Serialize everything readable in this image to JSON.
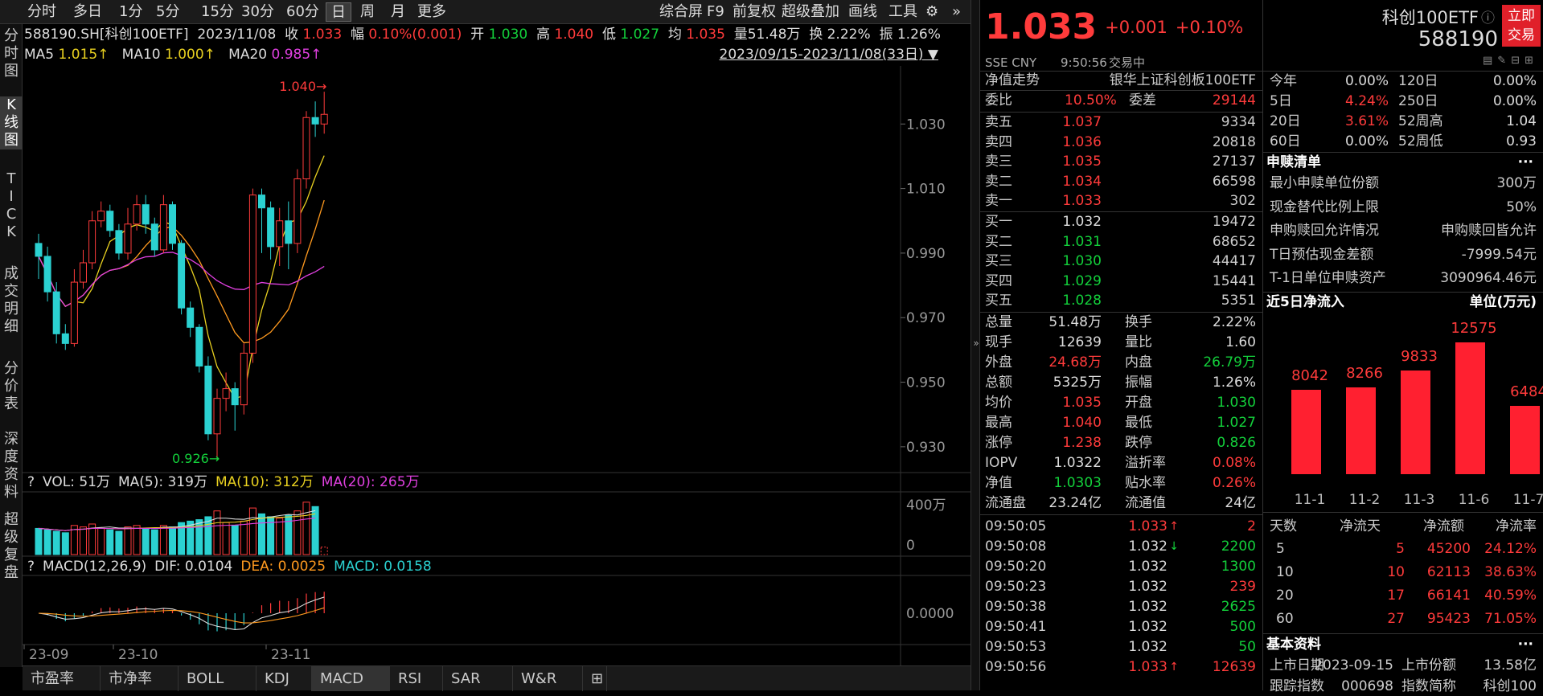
{
  "topbar": {
    "tabs": [
      "分时",
      "多日",
      "1分",
      "5分",
      "15分",
      "30分",
      "60分",
      "日",
      "周",
      "月",
      "更多"
    ],
    "active": "日",
    "tools": [
      "综合屏",
      "F9",
      "前复权",
      "超级叠加",
      "画线",
      "工具"
    ]
  },
  "vtabs": [
    "分时图",
    "K线图",
    "TICK",
    "成交明细",
    "分价表",
    "深度资料",
    "超级复盘"
  ],
  "info": {
    "code": "588190.SH[科创100ETF]",
    "date": "2023/11/08",
    "close_label": "收",
    "close": "1.033",
    "chg_label": "幅",
    "chg": "0.10%(0.001)",
    "open_label": "开",
    "open": "1.030",
    "high_label": "高",
    "high": "1.040",
    "low_label": "低",
    "low": "1.027",
    "avg_label": "均",
    "avg": "1.035",
    "vol_label": "量",
    "vol": "51.48万",
    "turn_label": "换",
    "turn": "2.22%",
    "amp_label": "振",
    "amp": "1.26%"
  },
  "ma": {
    "ma5_label": "MA5",
    "ma5": "1.015↑",
    "ma10_label": "MA10",
    "ma10": "1.000↑",
    "ma20_label": "MA20",
    "ma20": "0.985↑"
  },
  "range": "2023/09/15-2023/11/08(33日)",
  "vol_line": {
    "q": "?",
    "vol": "VOL: 51万",
    "ma5": "MA(5): 319万",
    "ma10": "MA(10): 312万",
    "ma20": "MA(20): 265万"
  },
  "macd_line": {
    "q": "?",
    "name": "MACD(12,26,9)",
    "dif": "DIF: 0.0104",
    "dea": "DEA: 0.0025",
    "macd": "MACD: 0.0158"
  },
  "bottomtabs": [
    "市盈率",
    "市净率",
    "BOLL",
    "KDJ",
    "MACD",
    "RSI",
    "SAR",
    "W&R",
    "⊞"
  ],
  "chart_data": {
    "type": "candlestick",
    "y_ticks": [
      "1.030",
      "1.010",
      "0.990",
      "0.970",
      "0.950",
      "0.930"
    ],
    "vol_ticks": [
      "400万",
      "0"
    ],
    "macd_ticks": [
      "0.0000"
    ],
    "x_ticks": [
      "23-09",
      "23-10",
      "23-11"
    ],
    "high_label": "1.040",
    "low_label": "0.926",
    "ylim": [
      0.922,
      1.048
    ],
    "candles": [
      [
        0.993,
        0.989,
        0.996,
        0.982
      ],
      [
        0.989,
        0.978,
        0.992,
        0.975
      ],
      [
        0.978,
        0.965,
        0.981,
        0.962
      ],
      [
        0.965,
        0.962,
        0.968,
        0.96
      ],
      [
        0.962,
        0.981,
        0.985,
        0.961
      ],
      [
        0.981,
        0.987,
        0.991,
        0.979
      ],
      [
        0.987,
        1.0,
        1.003,
        0.985
      ],
      [
        1.0,
        1.003,
        1.006,
        0.998
      ],
      [
        1.003,
        0.997,
        1.005,
        0.995
      ],
      [
        0.997,
        0.99,
        0.999,
        0.988
      ],
      [
        0.99,
        0.999,
        1.004,
        0.988
      ],
      [
        0.999,
        1.005,
        1.008,
        0.997
      ],
      [
        1.005,
        0.999,
        1.008,
        0.996
      ],
      [
        0.999,
        0.991,
        1.001,
        0.989
      ],
      [
        0.991,
        1.005,
        1.008,
        0.99
      ],
      [
        1.005,
        0.993,
        1.006,
        0.991
      ],
      [
        0.993,
        0.973,
        0.994,
        0.971
      ],
      [
        0.973,
        0.967,
        0.975,
        0.964
      ],
      [
        0.967,
        0.955,
        0.968,
        0.953
      ],
      [
        0.955,
        0.934,
        0.958,
        0.932
      ],
      [
        0.934,
        0.945,
        0.948,
        0.926
      ],
      [
        0.945,
        0.948,
        0.953,
        0.941
      ],
      [
        0.948,
        0.943,
        0.95,
        0.935
      ],
      [
        0.943,
        0.959,
        0.962,
        0.94
      ],
      [
        0.959,
        1.008,
        1.01,
        0.956
      ],
      [
        1.008,
        1.004,
        1.01,
        0.99
      ],
      [
        1.004,
        0.992,
        1.006,
        0.988
      ],
      [
        0.992,
        1.0,
        1.004,
        0.986
      ],
      [
        1.0,
        0.993,
        1.006,
        0.985
      ],
      [
        0.993,
        1.013,
        1.016,
        0.99
      ],
      [
        1.013,
        1.032,
        1.034,
        1.01
      ],
      [
        1.032,
        1.03,
        1.037,
        1.026
      ],
      [
        1.03,
        1.033,
        1.04,
        1.027
      ]
    ],
    "volumes": [
      180,
      170,
      160,
      150,
      200,
      190,
      210,
      180,
      170,
      160,
      190,
      200,
      180,
      170,
      200,
      190,
      220,
      230,
      240,
      260,
      300,
      220,
      200,
      230,
      320,
      280,
      260,
      250,
      270,
      300,
      360,
      330,
      51
    ],
    "series": [
      {
        "name": "MA5",
        "color": "#e8d020"
      },
      {
        "name": "MA10",
        "color": "#ff9a1f"
      },
      {
        "name": "MA20",
        "color": "#e040e0"
      }
    ]
  },
  "quote": {
    "price": "1.033",
    "chg": "+0.001",
    "pct": "+0.10%",
    "name": "科创100ETF",
    "code": "588190",
    "btn1": "立即",
    "btn2": "交易",
    "market": "SSE CNY",
    "time": "9:50:56",
    "status": "交易中"
  },
  "nav": {
    "label": "净值走势",
    "fund": "银华上证科创板100ETF"
  },
  "weibi": {
    "l1": "委比",
    "v1": "10.50%",
    "l2": "委差",
    "v2": "29144"
  },
  "asks": [
    {
      "l": "卖五",
      "p": "1.037",
      "v": "9334"
    },
    {
      "l": "卖四",
      "p": "1.036",
      "v": "20818"
    },
    {
      "l": "卖三",
      "p": "1.035",
      "v": "27137"
    },
    {
      "l": "卖二",
      "p": "1.034",
      "v": "66598"
    },
    {
      "l": "卖一",
      "p": "1.033",
      "v": "302"
    }
  ],
  "bids": [
    {
      "l": "买一",
      "p": "1.032",
      "v": "19472"
    },
    {
      "l": "买二",
      "p": "1.031",
      "v": "68652"
    },
    {
      "l": "买三",
      "p": "1.030",
      "v": "44417"
    },
    {
      "l": "买四",
      "p": "1.029",
      "v": "15441"
    },
    {
      "l": "买五",
      "p": "1.028",
      "v": "5351"
    }
  ],
  "stats": [
    {
      "l1": "总量",
      "v1": "51.48万",
      "c1": "white",
      "l2": "换手",
      "v2": "2.22%",
      "c2": "white"
    },
    {
      "l1": "现手",
      "v1": "12639",
      "c1": "white",
      "l2": "量比",
      "v2": "1.60",
      "c2": "white"
    },
    {
      "l1": "外盘",
      "v1": "24.68万",
      "c1": "red",
      "l2": "内盘",
      "v2": "26.79万",
      "c2": "green"
    },
    {
      "l1": "总额",
      "v1": "5325万",
      "c1": "white",
      "l2": "振幅",
      "v2": "1.26%",
      "c2": "white"
    },
    {
      "l1": "均价",
      "v1": "1.035",
      "c1": "red",
      "l2": "开盘",
      "v2": "1.030",
      "c2": "green"
    },
    {
      "l1": "最高",
      "v1": "1.040",
      "c1": "red",
      "l2": "最低",
      "v2": "1.027",
      "c2": "green"
    },
    {
      "l1": "涨停",
      "v1": "1.238",
      "c1": "red",
      "l2": "跌停",
      "v2": "0.826",
      "c2": "green"
    },
    {
      "l1": "IOPV",
      "v1": "1.0322",
      "c1": "white",
      "l2": "溢折率",
      "v2": "0.08%",
      "c2": "red"
    },
    {
      "l1": "净值",
      "v1": "1.0303",
      "c1": "green",
      "l2": "贴水率",
      "v2": "0.26%",
      "c2": "red"
    },
    {
      "l1": "流通盘",
      "v1": "23.24亿",
      "c1": "white",
      "l2": "流通值",
      "v2": "24亿",
      "c2": "white"
    }
  ],
  "ticks": [
    {
      "t": "09:50:05",
      "p": "1.033",
      "pc": "red",
      "a": "↑",
      "v": "2",
      "vc": "red"
    },
    {
      "t": "09:50:08",
      "p": "1.032",
      "pc": "white",
      "a": "↓",
      "v": "2200",
      "vc": "green"
    },
    {
      "t": "09:50:20",
      "p": "1.032",
      "pc": "white",
      "a": "",
      "v": "1300",
      "vc": "green"
    },
    {
      "t": "09:50:23",
      "p": "1.032",
      "pc": "white",
      "a": "",
      "v": "239",
      "vc": "red"
    },
    {
      "t": "09:50:38",
      "p": "1.032",
      "pc": "white",
      "a": "",
      "v": "2625",
      "vc": "green"
    },
    {
      "t": "09:50:41",
      "p": "1.032",
      "pc": "white",
      "a": "",
      "v": "500",
      "vc": "green"
    },
    {
      "t": "09:50:53",
      "p": "1.032",
      "pc": "white",
      "a": "",
      "v": "50",
      "vc": "green"
    },
    {
      "t": "09:50:56",
      "p": "1.033",
      "pc": "red",
      "a": "↑",
      "v": "12639",
      "vc": "red"
    }
  ],
  "perf": [
    {
      "l1": "今年",
      "v1": "0.00%",
      "c1": "white",
      "l2": "120日",
      "v2": "0.00%",
      "c2": "white"
    },
    {
      "l1": "5日",
      "v1": "4.24%",
      "c1": "red",
      "l2": "250日",
      "v2": "0.00%",
      "c2": "white"
    },
    {
      "l1": "20日",
      "v1": "3.61%",
      "c1": "red",
      "l2": "52周高",
      "v2": "1.04",
      "c2": "white"
    },
    {
      "l1": "60日",
      "v1": "0.00%",
      "c1": "white",
      "l2": "52周低",
      "v2": "0.93",
      "c2": "white"
    }
  ],
  "redeem": {
    "title": "申赎清单",
    "more": "···",
    "rows": [
      {
        "l": "最小申赎单位份额",
        "v": "300万"
      },
      {
        "l": "现金替代比例上限",
        "v": "50%"
      },
      {
        "l": "申购赎回允许情况",
        "v": "申购赎回皆允许"
      },
      {
        "l": "T日预估现金差额",
        "v": "-7999.54元"
      },
      {
        "l": "T-1日单位申赎资产",
        "v": "3090964.46元"
      }
    ]
  },
  "inflow": {
    "title": "近5日净流入",
    "unit": "单位(万元)",
    "bars": [
      {
        "d": "11-1",
        "v": 8042
      },
      {
        "d": "11-2",
        "v": 8266
      },
      {
        "d": "11-3",
        "v": 9833
      },
      {
        "d": "11-6",
        "v": 12575
      },
      {
        "d": "11-7",
        "v": 6484
      }
    ]
  },
  "flow_table": {
    "headers": [
      "天数",
      "净流天",
      "净流额",
      "净流率"
    ],
    "rows": [
      [
        "5",
        "5",
        "45200",
        "24.12%"
      ],
      [
        "10",
        "10",
        "62113",
        "38.63%"
      ],
      [
        "20",
        "17",
        "66141",
        "40.59%"
      ],
      [
        "60",
        "27",
        "95423",
        "71.05%"
      ]
    ]
  },
  "basic": {
    "title": "基本资料",
    "more": "···",
    "l1": "上市日期",
    "v1": "2023-09-15",
    "l2": "上市份额",
    "v2": "13.58亿",
    "l3": "跟踪指数",
    "v3": "000698",
    "l4": "指数简称",
    "v4": "科创100"
  }
}
